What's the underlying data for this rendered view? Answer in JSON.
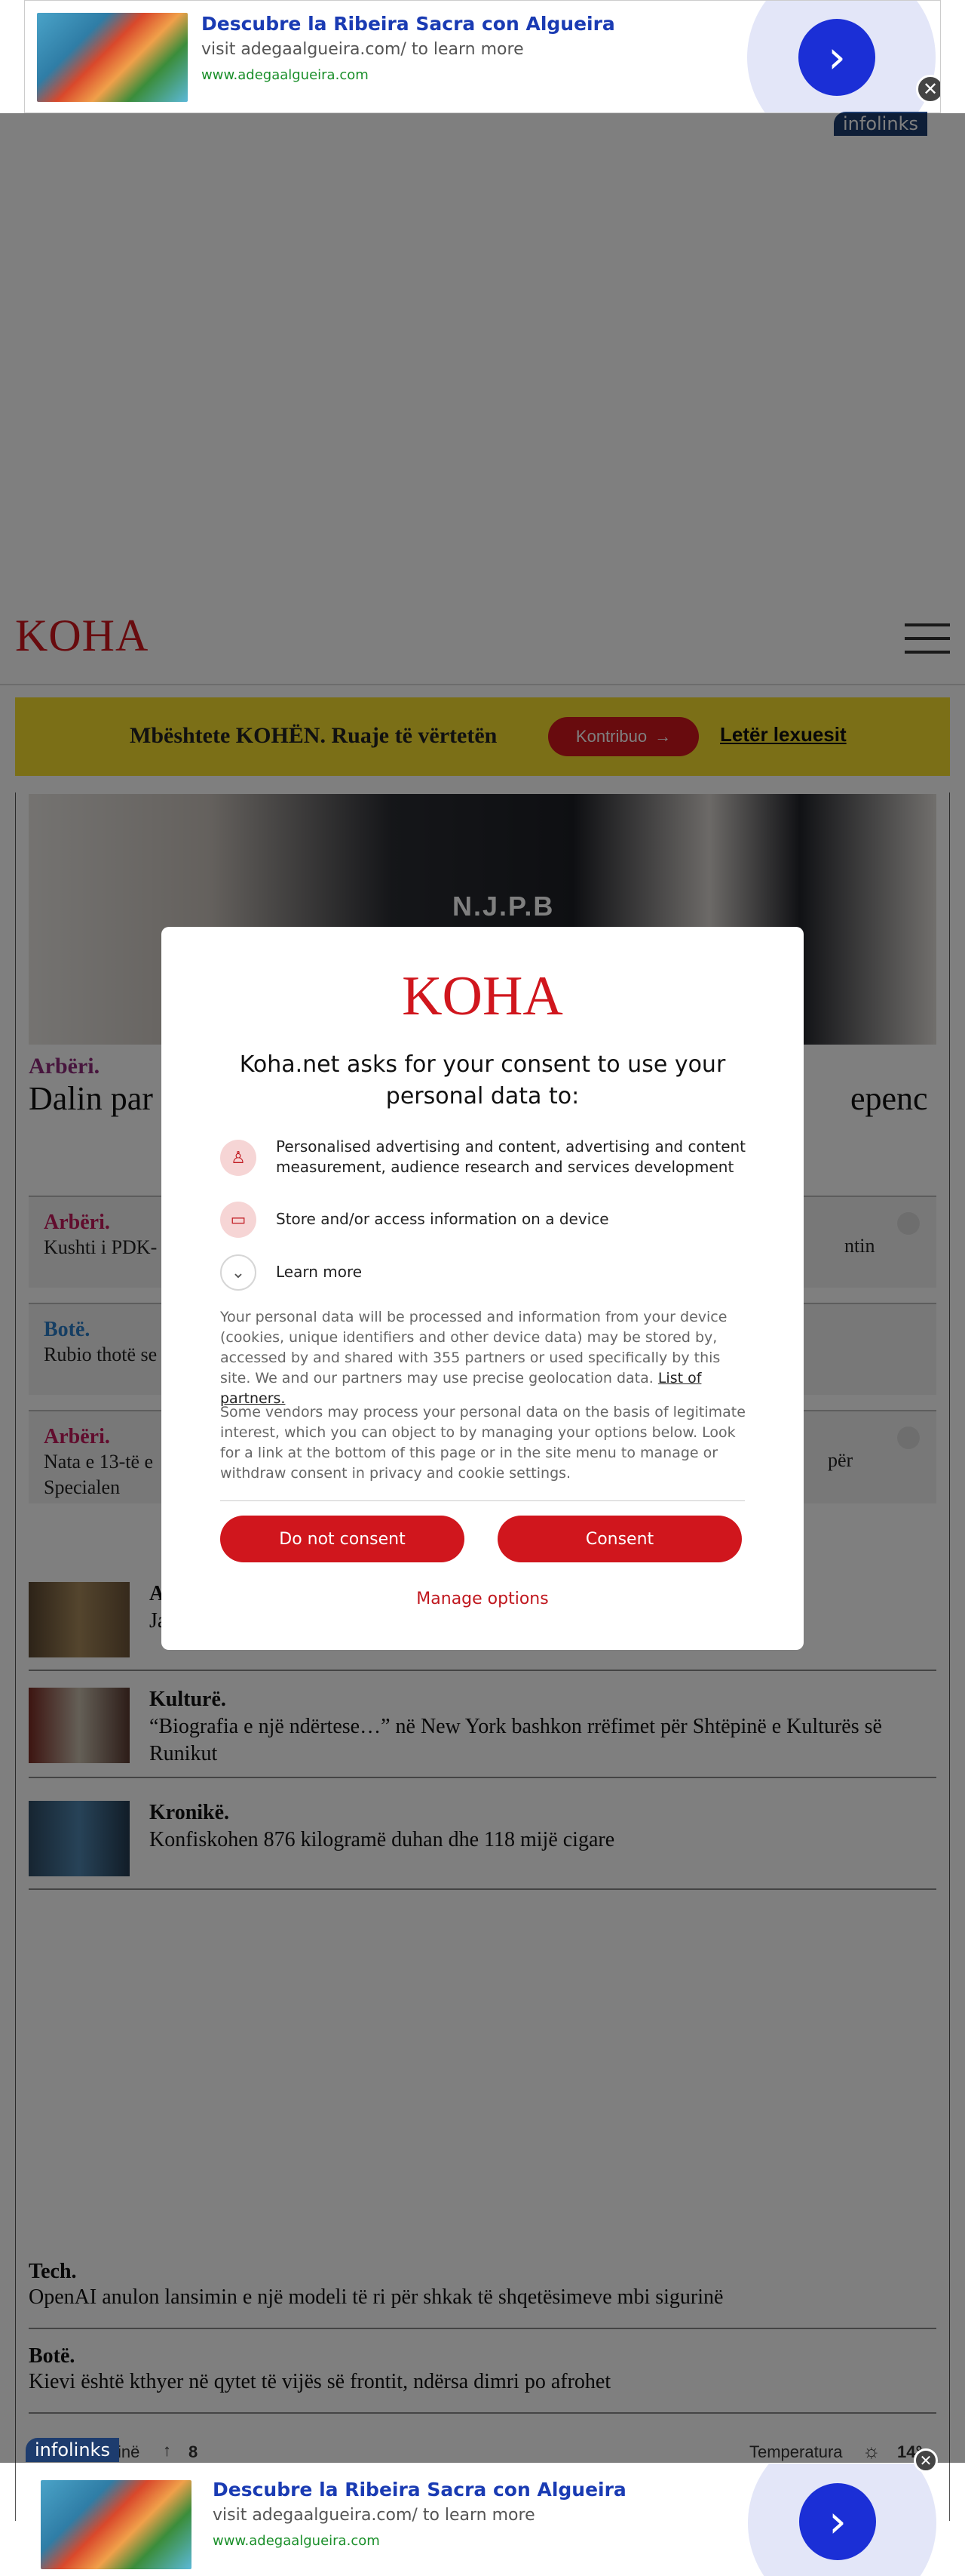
{
  "ad": {
    "title": "Descubre la Ribeira Sacra con Algueira",
    "description": "visit adegaalgueira.com/ to learn more",
    "url": "www.adegaalgueira.com",
    "go_icon": "chevron-right-icon",
    "close": "✕",
    "network": "infolinks"
  },
  "site": {
    "logo": "KOHA",
    "menu_icon": "hamburger-menu-icon"
  },
  "support": {
    "text": "Mbështete KOHËN. Ruaje të vërtetën",
    "button": "Kontribuo",
    "link": "Letër lexuesit"
  },
  "hero": {
    "image_text": "N.J.P.B",
    "category": "Arbëri.",
    "title_left": "Dalin par",
    "title_right": "epenc"
  },
  "live_boxes": [
    {
      "category": "Arbëri.",
      "category_color": "#c2185b",
      "text": "Kushti i PDK-",
      "right": "ntin"
    },
    {
      "category": "Botë.",
      "category_color": "#2a7dc6",
      "text": "Rubio thotë se",
      "right": ""
    },
    {
      "category": "Arbëri.",
      "category_color": "#c2185b",
      "text": "Nata e 13-të e",
      "text2": "Specialen",
      "right": "për"
    }
  ],
  "news": [
    {
      "category": "A",
      "title": "Ja"
    },
    {
      "category": "Kulturë.",
      "title": "“Biografia e një ndërtese…” në New York bashkon rrëfimet për Shtëpinë e Kulturës së Runikut"
    },
    {
      "category": "Kronikë.",
      "title": "Konfiskohen 876 kilogramë duhan dhe 118 mijë cigare"
    }
  ],
  "plain_news": [
    {
      "category": "Tech.",
      "title": "OpenAI anulon lansimin e një modeli të ri për shkak të shqetësimeve mbi sigurinë"
    },
    {
      "category": "Botë.",
      "title": "Kievi është kthyer në qytet të vijës së frontit, ndërsa dimri po afrohet"
    }
  ],
  "footer": {
    "left_text": "inë",
    "count": "8",
    "temperature_label": "Temperatura",
    "temperature_value": "14°"
  },
  "consent": {
    "logo": "KOHA",
    "heading": "Koha.net asks for your consent to use your personal data to:",
    "purposes": [
      {
        "icon": "person-icon",
        "text": "Personalised advertising and content, advertising and content measurement, audience research and services development"
      },
      {
        "icon": "devices-icon",
        "text": "Store and/or access information on a device"
      }
    ],
    "learn_more": "Learn more",
    "para1": "Your personal data will be processed and information from your device (cookies, unique identifiers and other device data) may be stored by, accessed by and shared with 355 partners or used specifically by this site. We and our partners may use precise geolocation data.",
    "partners_link": "List of partners.",
    "para2": "Some vendors may process your personal data on the basis of legitimate interest, which you can object to by managing your options below. Look for a link at the bottom of this page or in the site menu to manage or withdraw consent in privacy and cookie settings.",
    "do_not_consent": "Do not consent",
    "consent": "Consent",
    "manage": "Manage options"
  }
}
